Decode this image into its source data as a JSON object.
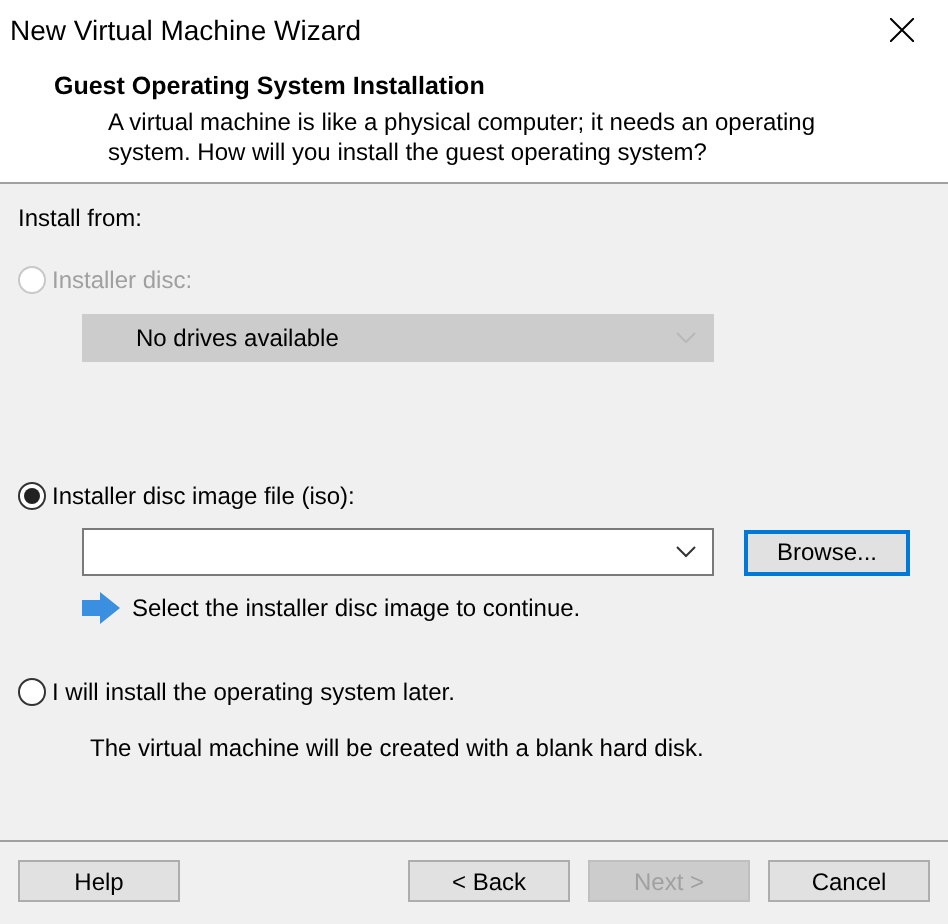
{
  "window": {
    "title": "New Virtual Machine Wizard"
  },
  "header": {
    "title": "Guest Operating System Installation",
    "description": "A virtual machine is like a physical computer; it needs an operating system. How will you install the guest operating system?"
  },
  "group_label": "Install from:",
  "options": [
    {
      "kind": "disc",
      "label": "Installer disc:",
      "selected": false,
      "disabled": true,
      "dropdown": {
        "value": "No drives available",
        "disabled": true
      }
    },
    {
      "kind": "iso",
      "label": "Installer disc image file (iso):",
      "selected": true,
      "disabled": false,
      "browse": "Browse...",
      "hint": "Select the installer disc image to continue."
    },
    {
      "kind": "later",
      "label": "I will install the operating system later.",
      "selected": false,
      "disabled": false,
      "note": "The virtual machine will be created with a blank hard disk."
    }
  ],
  "buttons": [
    {
      "label": "Help",
      "disabled": false
    },
    {
      "label": "< Back",
      "disabled": false
    },
    {
      "label": "Next >",
      "disabled": true
    },
    {
      "label": "Cancel",
      "disabled": false
    }
  ]
}
